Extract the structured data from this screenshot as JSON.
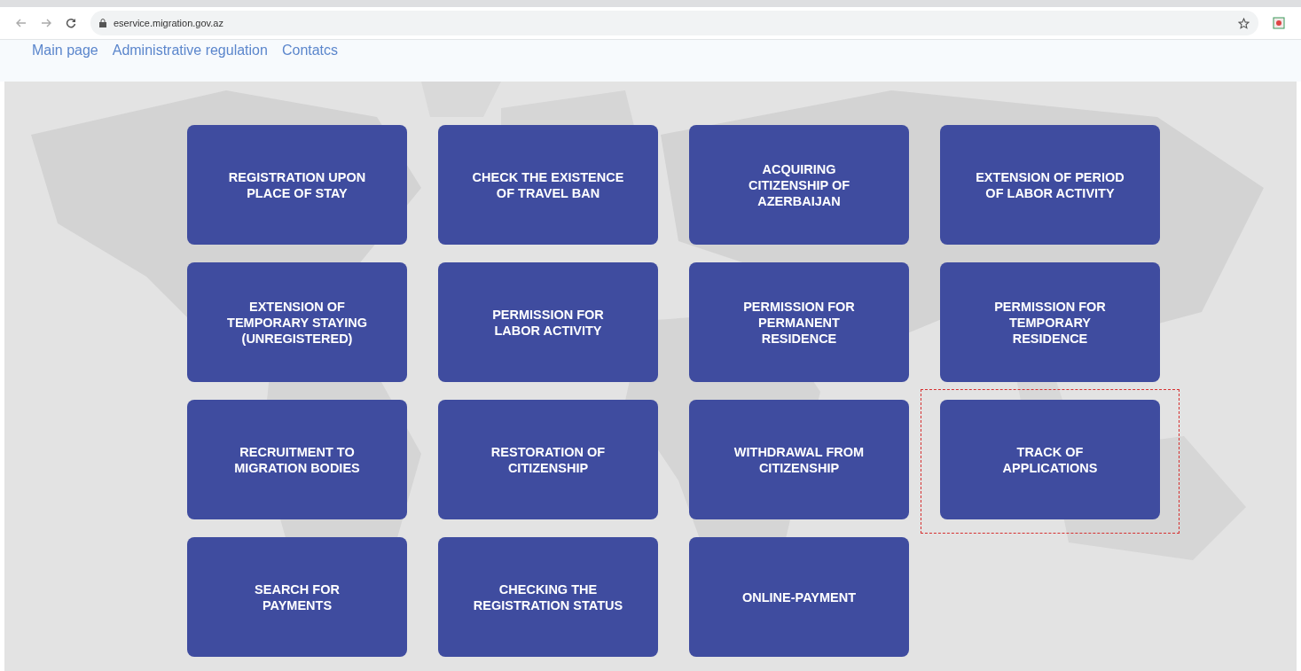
{
  "browser": {
    "url": "eservice.migration.gov.az"
  },
  "nav": [
    {
      "label": "Main page"
    },
    {
      "label": "Administrative regulation"
    },
    {
      "label": "Contatcs"
    }
  ],
  "tiles": [
    {
      "label": "REGISTRATION UPON PLACE OF STAY",
      "highlighted": false
    },
    {
      "label": "CHECK THE EXISTENCE OF TRAVEL BAN",
      "highlighted": false
    },
    {
      "label": "ACQUIRING CITIZENSHIP OF AZERBAIJAN",
      "highlighted": false
    },
    {
      "label": "EXTENSION OF PERIOD OF LABOR ACTIVITY",
      "highlighted": false
    },
    {
      "label": "EXTENSION OF TEMPORARY STAYING (UNREGISTERED)",
      "highlighted": false
    },
    {
      "label": "PERMISSION FOR LABOR ACTIVITY",
      "highlighted": false
    },
    {
      "label": "PERMISSION FOR PERMANENT RESIDENCE",
      "highlighted": false
    },
    {
      "label": "PERMISSION FOR TEMPORARY RESIDENCE",
      "highlighted": false
    },
    {
      "label": "RECRUITMENT TO MIGRATION BODIES",
      "highlighted": false
    },
    {
      "label": "RESTORATION OF CITIZENSHIP",
      "highlighted": false
    },
    {
      "label": "WITHDRAWAL FROM CITIZENSHIP",
      "highlighted": false
    },
    {
      "label": "TRACK OF APPLICATIONS",
      "highlighted": true
    },
    {
      "label": "SEARCH FOR PAYMENTS",
      "highlighted": false
    },
    {
      "label": "CHECKING THE REGISTRATION STATUS",
      "highlighted": false
    },
    {
      "label": "ONLINE-PAYMENT",
      "highlighted": false
    }
  ]
}
